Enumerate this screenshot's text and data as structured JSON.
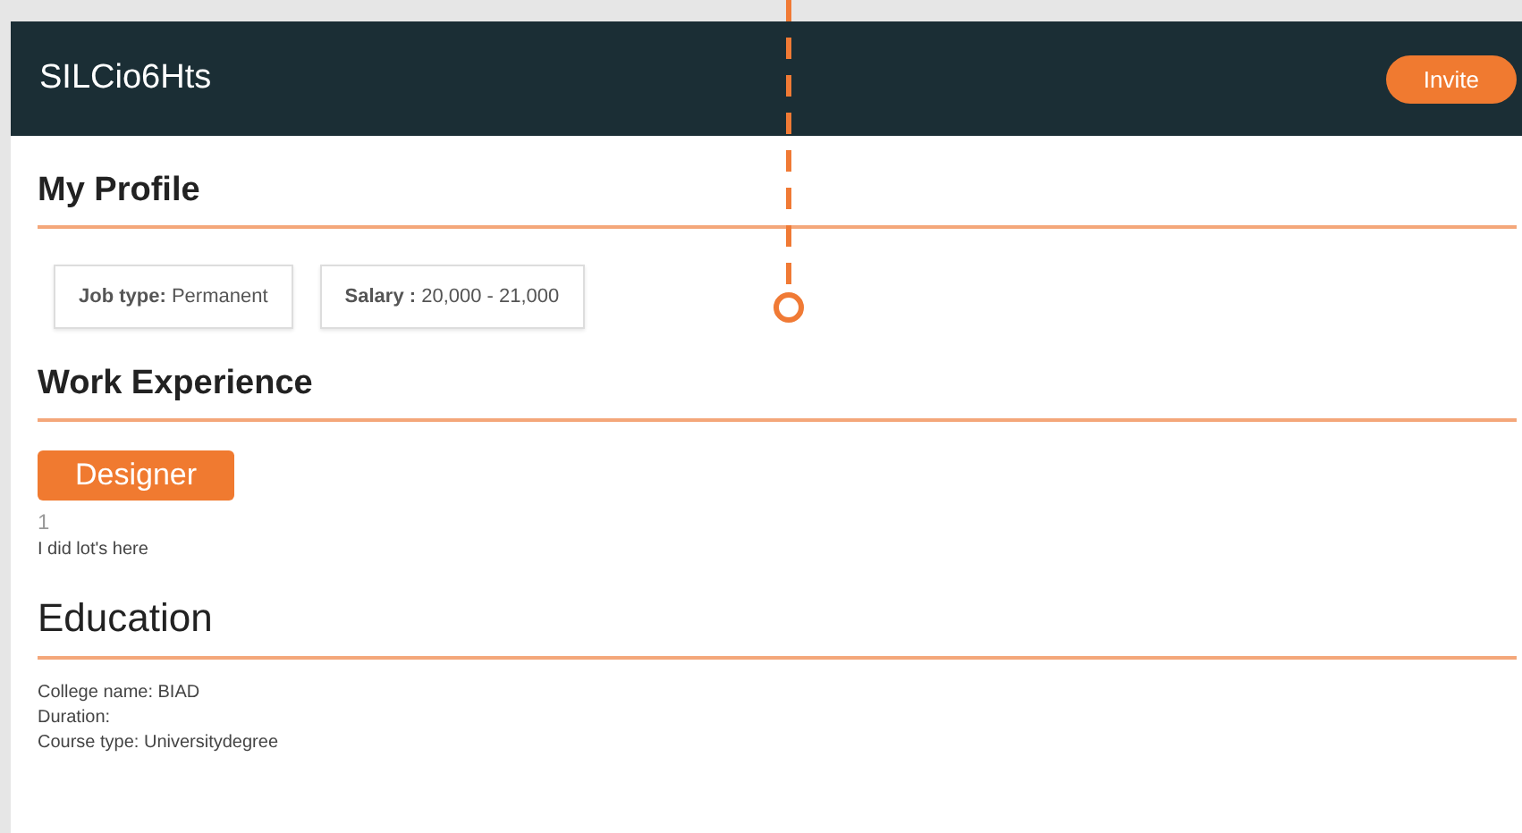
{
  "header": {
    "title": "SILCio6Hts",
    "action": "Invite"
  },
  "profile": {
    "heading": "My Profile",
    "chips": [
      "**Job type:** Permanent",
      "**Salary :** 20,000 - 21,000"
    ]
  },
  "work": {
    "heading": "Work Experience",
    "role": "Designer",
    "count": "1",
    "description": "I did lot's here"
  },
  "education": {
    "heading": "Education",
    "lines": [
      "College name: BIAD",
      "Duration:",
      "Course type: Universitydegree"
    ]
  }
}
